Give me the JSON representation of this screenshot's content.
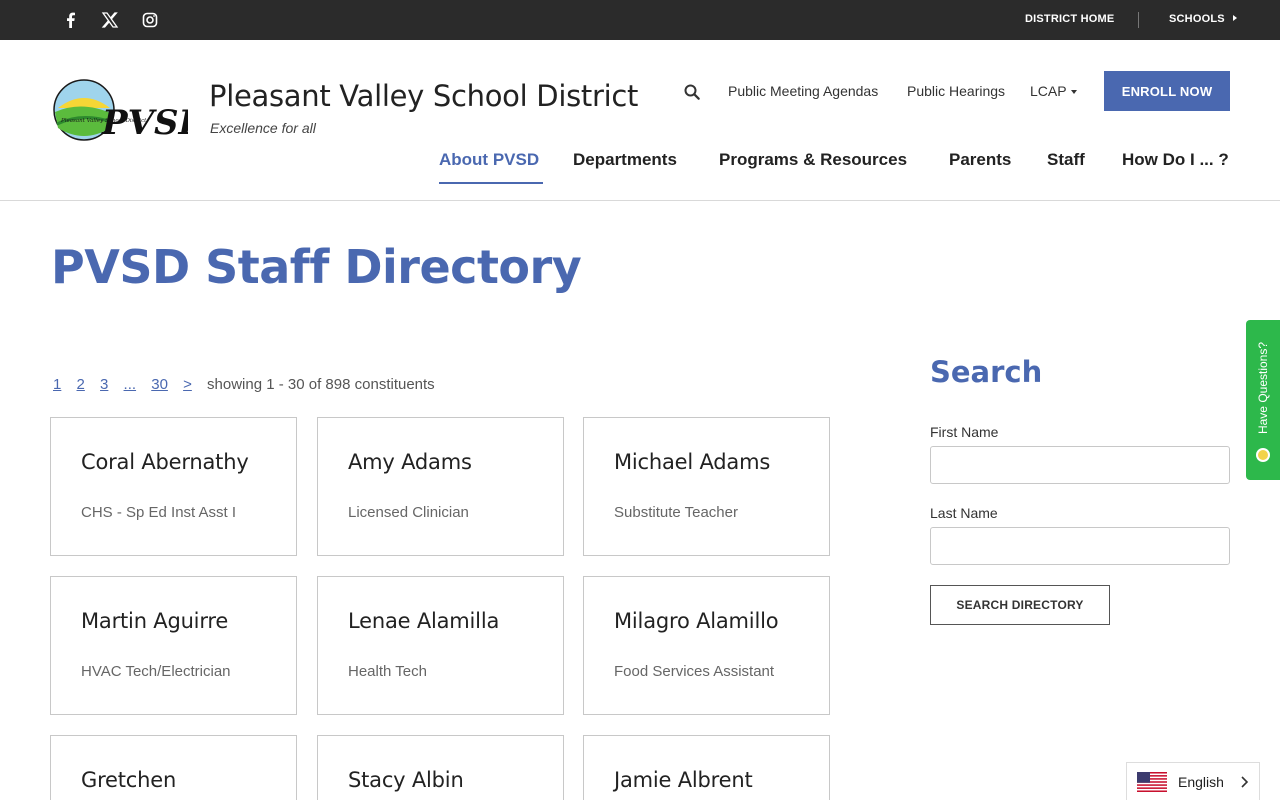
{
  "topbar": {
    "social": [
      {
        "icon": "facebook-icon"
      },
      {
        "icon": "x-twitter-icon"
      },
      {
        "icon": "instagram-icon"
      }
    ],
    "district_home": "DISTRICT HOME",
    "schools": "SCHOOLS"
  },
  "header": {
    "logo_text": "PVSD",
    "logo_small_text": "Pleasant Valley School District",
    "title": "Pleasant Valley School District",
    "tagline": "Excellence for all",
    "utility_links": [
      "Public Meeting Agendas",
      "Public Hearings",
      "LCAP"
    ],
    "enroll": "ENROLL NOW",
    "nav": [
      "About PVSD",
      "Departments",
      "Programs & Resources",
      "Parents",
      "Staff",
      "How Do I ... ?"
    ],
    "active_nav": "About PVSD"
  },
  "main": {
    "title": "PVSD Staff Directory",
    "pagination": {
      "pages": [
        "1",
        "2",
        "3",
        "...",
        "30",
        ">"
      ],
      "showing": "showing 1 - 30 of 898 constituents"
    },
    "staff": [
      {
        "name": "Coral Abernathy",
        "title": "CHS - Sp Ed Inst Asst I"
      },
      {
        "name": "Amy Adams",
        "title": "Licensed Clinician"
      },
      {
        "name": "Michael Adams",
        "title": "Substitute Teacher"
      },
      {
        "name": "Martin Aguirre",
        "title": "HVAC Tech/Electrician"
      },
      {
        "name": "Lenae Alamilla",
        "title": "Health Tech"
      },
      {
        "name": "Milagro Alamillo",
        "title": "Food Services Assistant"
      },
      {
        "name": "Gretchen",
        "title": ""
      },
      {
        "name": "Stacy Albin",
        "title": ""
      },
      {
        "name": "Jamie Albrent",
        "title": ""
      }
    ]
  },
  "search": {
    "heading": "Search",
    "first_name_label": "First Name",
    "last_name_label": "Last Name",
    "first_name_value": "",
    "last_name_value": "",
    "button": "SEARCH DIRECTORY"
  },
  "side_tab": {
    "label": "Have Questions?"
  },
  "language": {
    "label": "English"
  },
  "colors": {
    "brand_blue": "#4a68b0",
    "topbar": "#2b2b2b",
    "tab_green": "#2db84b"
  }
}
